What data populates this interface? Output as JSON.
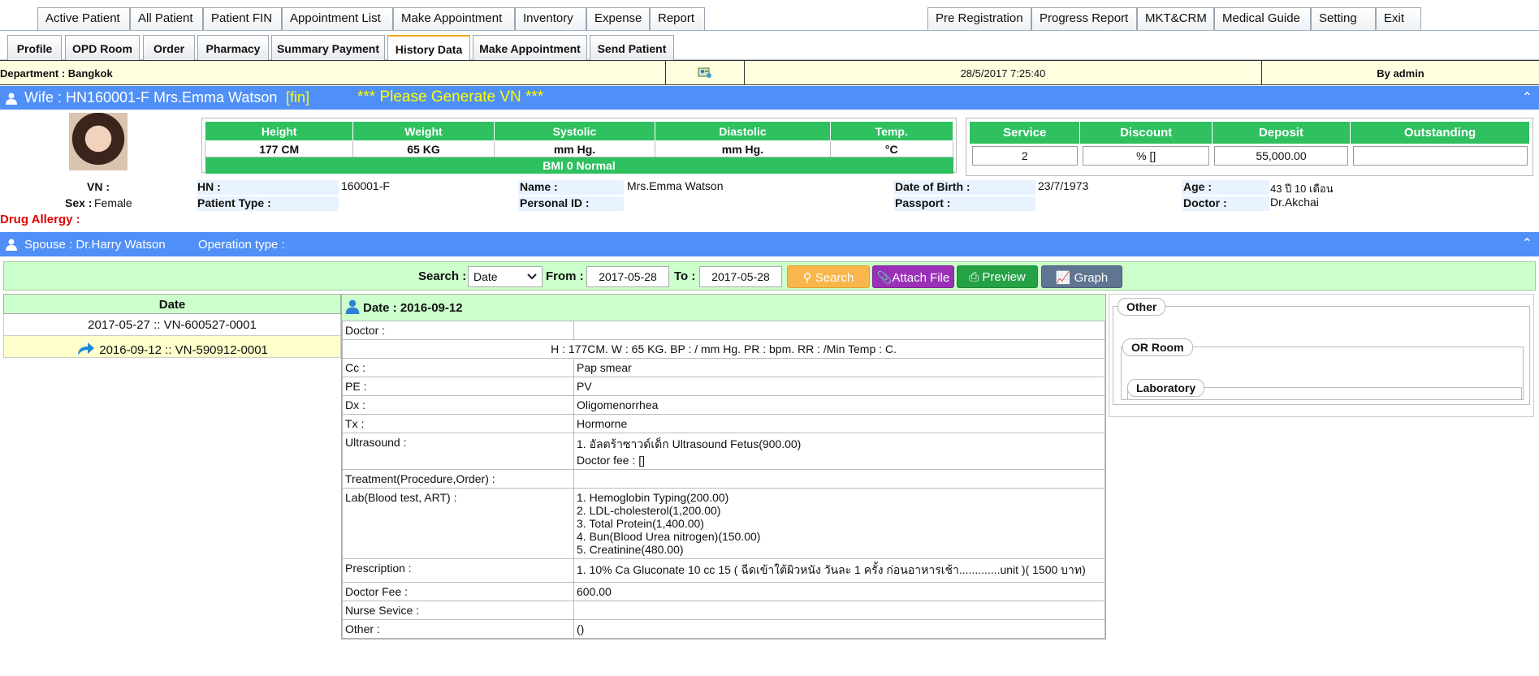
{
  "top_tabs": [
    "Active Patient",
    "All Patient",
    "Patient FIN",
    "Appointment List",
    "Make Appointment",
    "Inventory",
    "Expense",
    "Report"
  ],
  "top_tabs_right": [
    "Pre Registration",
    "Progress Report",
    "MKT&CRM",
    "Medical Guide",
    "Setting",
    "Exit"
  ],
  "sub_tabs": [
    "Profile",
    "OPD Room",
    "Order",
    "Pharmacy",
    "Summary Payment",
    "History Data",
    "Make Appointment",
    "Send Patient"
  ],
  "active_sub_tab": "History Data",
  "info_bar": {
    "department": "Department : Bangkok",
    "datetime": "28/5/2017 7:25:40",
    "by": "By admin"
  },
  "wife_header": {
    "title": "Wife : HN160001-F Mrs.Emma Watson ",
    "fin": "[fin]",
    "notice": "*** Please Generate VN ***"
  },
  "vitals": {
    "headers": [
      "Height",
      "Weight",
      "Systolic",
      "Diastolic",
      "Temp."
    ],
    "values": [
      "177 CM",
      "65 KG",
      "mm Hg.",
      "mm Hg.",
      "°C"
    ],
    "bmi": "BMI 0   Normal"
  },
  "money": {
    "headers": [
      "Service",
      "Discount",
      "Deposit",
      "Outstanding"
    ],
    "values": [
      "2",
      "% []",
      "55,000.00",
      ""
    ]
  },
  "demographics": {
    "vn_label": "VN :",
    "vn": "",
    "sex_label": "Sex :",
    "sex": "Female",
    "drug_allergy": "Drug Allergy :",
    "hn_label": "HN :",
    "hn": "160001-F",
    "patient_type_label": "Patient Type :",
    "name_label": "Name :",
    "name": "Mrs.Emma Watson",
    "personal_id_label": "Personal ID :",
    "dob_label": "Date of Birth :",
    "dob": "23/7/1973",
    "passport_label": "Passport :",
    "age_label": "Age :",
    "age": "43 ปี 10 เดือน",
    "doctor_label": "Doctor :",
    "doctor": "Dr.Akchai"
  },
  "spouse_header": {
    "spouse": "Spouse : Dr.Harry Watson",
    "operation": "Operation type :"
  },
  "search": {
    "label": "Search :",
    "type": "Date",
    "from_label": "From :",
    "from": "2017-05-28",
    "to_label": "To :",
    "to": "2017-05-28",
    "search_btn": "Search",
    "attach_btn": "Attach File",
    "preview_btn": "Preview",
    "graph_btn": "Graph"
  },
  "date_list": {
    "header": "Date",
    "rows": [
      "2017-05-27 :: VN-600527-0001",
      "2016-09-12 :: VN-590912-0001"
    ]
  },
  "detail": {
    "title": "Date : 2016-09-12",
    "doctor_label": "Doctor :",
    "vitals_line": "H : 177CM.   W : 65 KG.   BP : / mm Hg.   PR :   bpm.   RR :  /Min   Temp : C.",
    "rows": [
      {
        "k": "Cc :",
        "v": [
          "Pap smear"
        ]
      },
      {
        "k": "PE :",
        "v": [
          "PV"
        ]
      },
      {
        "k": "Dx :",
        "v": [
          "Oligomenorrhea"
        ]
      },
      {
        "k": "Tx :",
        "v": [
          "Hormorne"
        ]
      },
      {
        "k": "Ultrasound :",
        "v": [
          "1. อัลตร้าซาวด์เด็ก Ultrasound Fetus(900.00)",
          "Doctor fee : []"
        ]
      },
      {
        "k": "Treatment(Procedure,Order) :",
        "v": [
          ""
        ]
      },
      {
        "k": "Lab(Blood test, ART) :",
        "v": [
          "1. Hemoglobin Typing(200.00)",
          "2. LDL-cholesterol(1,200.00)",
          "3. Total Protein(1,400.00)",
          "4. Bun(Blood Urea nitrogen)(150.00)",
          "5. Creatinine(480.00)"
        ]
      },
      {
        "k": "Prescription :",
        "v": [
          "1. 10% Ca Gluconate 10 cc 15 ( ฉีดเข้าใต้ผิวหนัง วันละ 1 ครั้ง ก่อนอาหารเช้า.............unit )( 1500 บาท)"
        ]
      },
      {
        "k": "Doctor Fee :",
        "v": [
          "600.00"
        ]
      },
      {
        "k": "Nurse Sevice :",
        "v": [
          ""
        ]
      },
      {
        "k": "Other :",
        "v": [
          "()"
        ]
      }
    ]
  },
  "other_panel": {
    "other": "Other",
    "or_room": "OR Room",
    "laboratory": "Laboratory"
  },
  "colors": {
    "blue_header": "#4f8ff7",
    "green": "#2fc060",
    "light_green": "#ccffcc",
    "orange_btn": "#f9b64a",
    "purple_btn": "#9b30b8",
    "green_btn": "#25a146",
    "slate_btn": "#5f7591",
    "allergy_red": "#e00000",
    "fin_yellow": "#ffff00"
  }
}
